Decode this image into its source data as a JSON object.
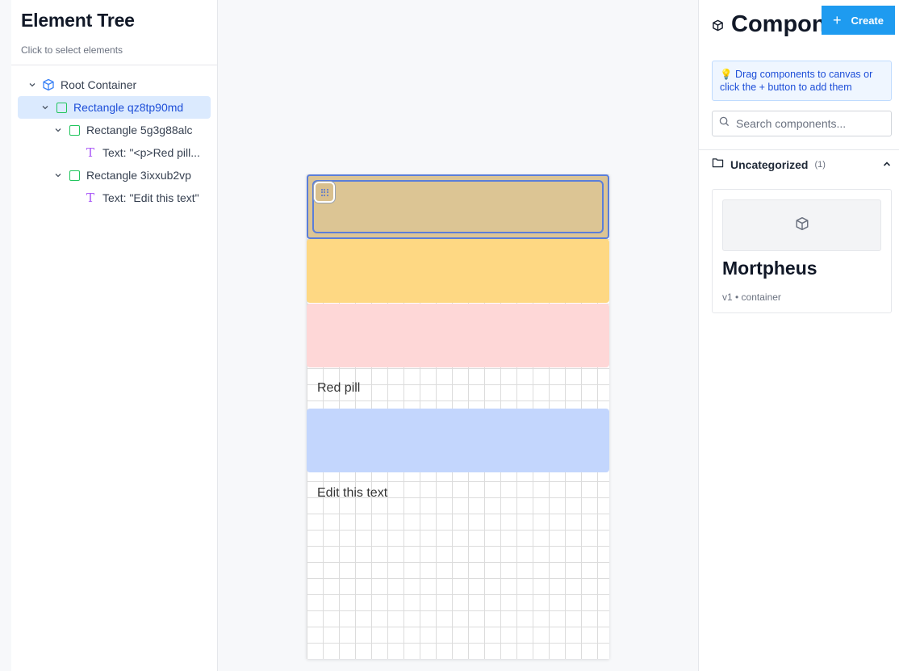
{
  "element_tree": {
    "title": "Element Tree",
    "subtitle": "Click to select elements",
    "nodes": [
      {
        "label": "Root Container",
        "icon": "cube-icon"
      },
      {
        "label": "Rectangle qz8tp90md",
        "icon": "rectangle-icon",
        "selected": true
      },
      {
        "label": "Rectangle 5g3g88alc",
        "icon": "rectangle-icon"
      },
      {
        "label": "Text: \"<p>Red pill...",
        "icon": "text-icon"
      },
      {
        "label": "Rectangle 3ixxub2vp",
        "icon": "rectangle-icon"
      },
      {
        "label": "Text: \"Edit this text\"",
        "icon": "text-icon"
      }
    ]
  },
  "canvas": {
    "text_red_pill": "Red pill",
    "text_edit": "Edit this text",
    "colors": {
      "selected_block": "#dcc594",
      "yellow_block": "#fed883",
      "pink_block": "#fed7d7",
      "blue_block": "#c3d6fd",
      "selection_outline": "#5b7ed9"
    }
  },
  "components": {
    "title": "Components",
    "create_label": "Create",
    "tip": "💡 Drag components to canvas or click the + button to add them",
    "search_placeholder": "Search components...",
    "category": {
      "label": "Uncategorized",
      "count": "(1)"
    },
    "cards": [
      {
        "name": "Mortpheus",
        "meta": "v1 • container"
      }
    ],
    "accent": "#1e9bf0"
  }
}
